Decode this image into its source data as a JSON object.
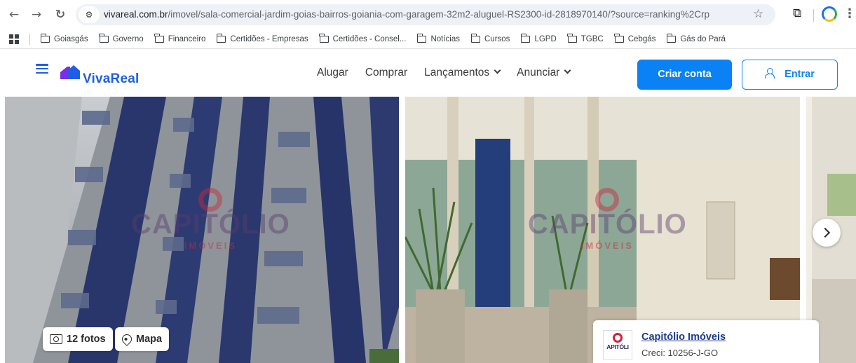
{
  "browser": {
    "url_domain": "vivareal.com.br",
    "url_path": "/imovel/sala-comercial-jardim-goias-bairros-goiania-com-garagem-32m2-aluguel-RS2300-id-2818970140/?source=ranking%2Crp",
    "bookmarks": [
      "Goiasgás",
      "Governo",
      "Financeiro",
      "Certidões - Empresas",
      "Certidões - Consel...",
      "Notícias",
      "Cursos",
      "LGPD",
      "TGBC",
      "Cebgás",
      "Gás do Pará"
    ]
  },
  "header": {
    "logo_text": "VivaReal",
    "nav": [
      "Alugar",
      "Comprar",
      "Lançamentos",
      "Anunciar"
    ],
    "create_account": "Criar conta",
    "login": "Entrar",
    "brand_color": "#1e5ee6",
    "accent_color": "#0a82f5"
  },
  "gallery": {
    "photos_label": "12 fotos",
    "map_label": "Mapa",
    "watermark_title": "CAPITÓLIO",
    "watermark_sub": "IMÓVEIS"
  },
  "agency": {
    "name": "Capitólio Imóveis",
    "creci": "Creci: 10256-J-GO",
    "logo_text": "APITÓLI"
  }
}
